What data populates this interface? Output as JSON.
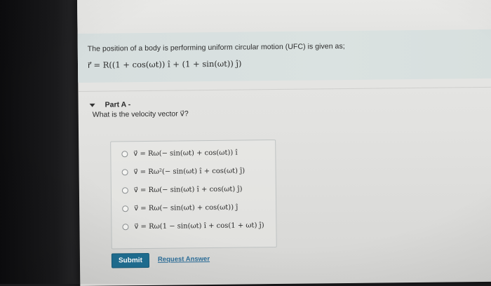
{
  "question": {
    "text": "The position of a body is performing uniform circular motion (UFC) is given as;",
    "formula": "r⃗ = R((1 + cos(ωt)) î + (1 + sin(ωt)) ĵ)"
  },
  "part": {
    "title": "Part A -",
    "question": "What is the velocity vector v⃗?"
  },
  "options": [
    {
      "formula": "v⃗ = Rω(− sin(ωt) + cos(ωt)) î"
    },
    {
      "formula": "v⃗ = Rω²(− sin(ωt) î + cos(ωt) ĵ)"
    },
    {
      "formula": "v⃗ = Rω(− sin(ωt) î + cos(ωt) ĵ)"
    },
    {
      "formula": "v⃗ = Rω(− sin(ωt) + cos(ωt)) ĵ"
    },
    {
      "formula": "v⃗ = Rω(1 − sin(ωt) î + cos(1 + ωt) ĵ)"
    }
  ],
  "actions": {
    "submit_label": "Submit",
    "request_label": "Request Answer"
  }
}
